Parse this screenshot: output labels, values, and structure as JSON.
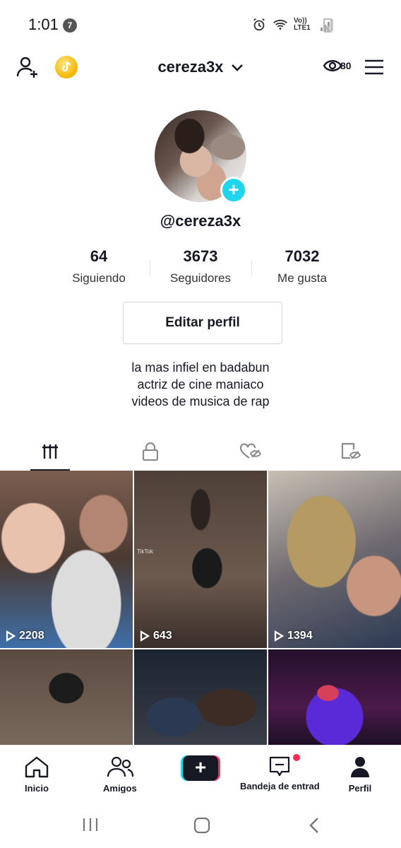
{
  "status_bar": {
    "time": "1:01",
    "notification_count": "7",
    "network_label": "Vo)) LTE1"
  },
  "header": {
    "username": "cereza3x",
    "profile_views": "80"
  },
  "profile": {
    "handle": "@cereza3x",
    "stats": [
      {
        "value": "64",
        "label": "Siguiendo"
      },
      {
        "value": "3673",
        "label": "Seguidores"
      },
      {
        "value": "7032",
        "label": "Me gusta"
      }
    ],
    "edit_button": "Editar perfil",
    "bio": [
      "la mas infiel en badabun",
      "actriz de cine maniaco",
      "videos de musica de rap"
    ]
  },
  "tabs": [
    {
      "icon": "videos-grid-icon",
      "active": true
    },
    {
      "icon": "lock-icon",
      "active": false
    },
    {
      "icon": "liked-hidden-icon",
      "active": false
    },
    {
      "icon": "favorites-hidden-icon",
      "active": false
    }
  ],
  "videos": [
    {
      "plays": "2208"
    },
    {
      "plays": "643"
    },
    {
      "plays": "1394"
    },
    {
      "plays": ""
    },
    {
      "plays": ""
    },
    {
      "plays": ""
    }
  ],
  "video_watermark": "TikTok",
  "bottom_nav": {
    "home": "Inicio",
    "friends": "Amigos",
    "inbox": "Bandeja de entrad",
    "profile": "Perfil"
  },
  "colors": {
    "accent_cyan": "#20d5ec",
    "accent_red": "#fe2c55",
    "text": "#161823"
  }
}
